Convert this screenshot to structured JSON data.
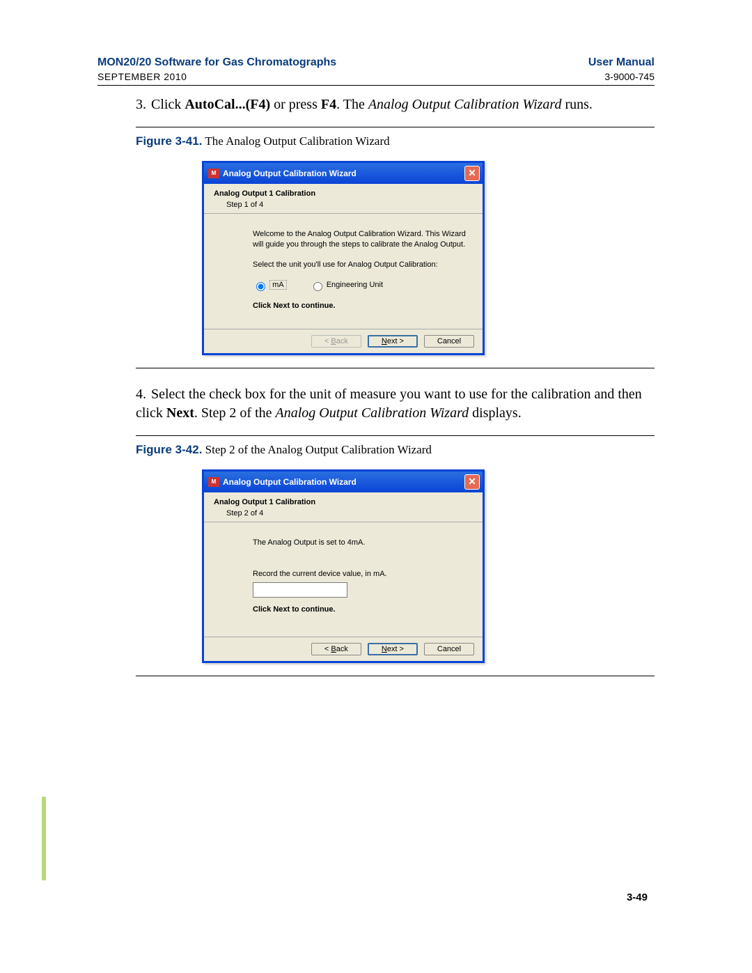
{
  "header": {
    "title_left": "MON20/20 Software for Gas Chromatographs",
    "date": "SEPTEMBER 2010",
    "title_right": "User Manual",
    "docnum": "3-9000-745"
  },
  "step3": {
    "num": "3.",
    "t1": "Click ",
    "bold1": "AutoCal...(F4)",
    "t2": " or press ",
    "bold2": "F4",
    "t3": ". The ",
    "ital": "Analog Output Calibration Wizard",
    "t4": " runs."
  },
  "fig41": {
    "label": "Figure 3-41.",
    "caption": "  The Analog Output Calibration Wizard"
  },
  "dlg1": {
    "title": "Analog Output Calibration Wizard",
    "cal_title": "Analog Output 1 Calibration",
    "step": "Step 1 of 4",
    "welcome": "Welcome to the Analog Output Calibration Wizard. This Wizard will guide you through the steps to calibrate the Analog Output.",
    "select_prompt": "Select the unit you'll use for Analog Output Calibration:",
    "radio_ma": "mA",
    "radio_eng": "Engineering Unit",
    "continue": "Click Next to continue.",
    "back": "< Back",
    "next": "Next >",
    "cancel": "Cancel"
  },
  "step4": {
    "num": "4.",
    "t1": "Select the check box for the unit of measure you want to use for the calibration and then click ",
    "bold1": "Next",
    "t2": ". Step 2 of the ",
    "ital": "Analog Output Calibration Wizard",
    "t3": " displays."
  },
  "fig42": {
    "label": "Figure 3-42.",
    "caption": "  Step 2 of the Analog Output Calibration Wizard"
  },
  "dlg2": {
    "title": "Analog Output Calibration Wizard",
    "cal_title": "Analog Output 1 Calibration",
    "step": "Step 2 of 4",
    "set_msg": "The Analog Output is set to 4mA.",
    "record_msg": "Record the current device value, in mA.",
    "continue": "Click Next to continue.",
    "back": "< Back",
    "next": "Next >",
    "cancel": "Cancel"
  },
  "page_number": "3-49"
}
